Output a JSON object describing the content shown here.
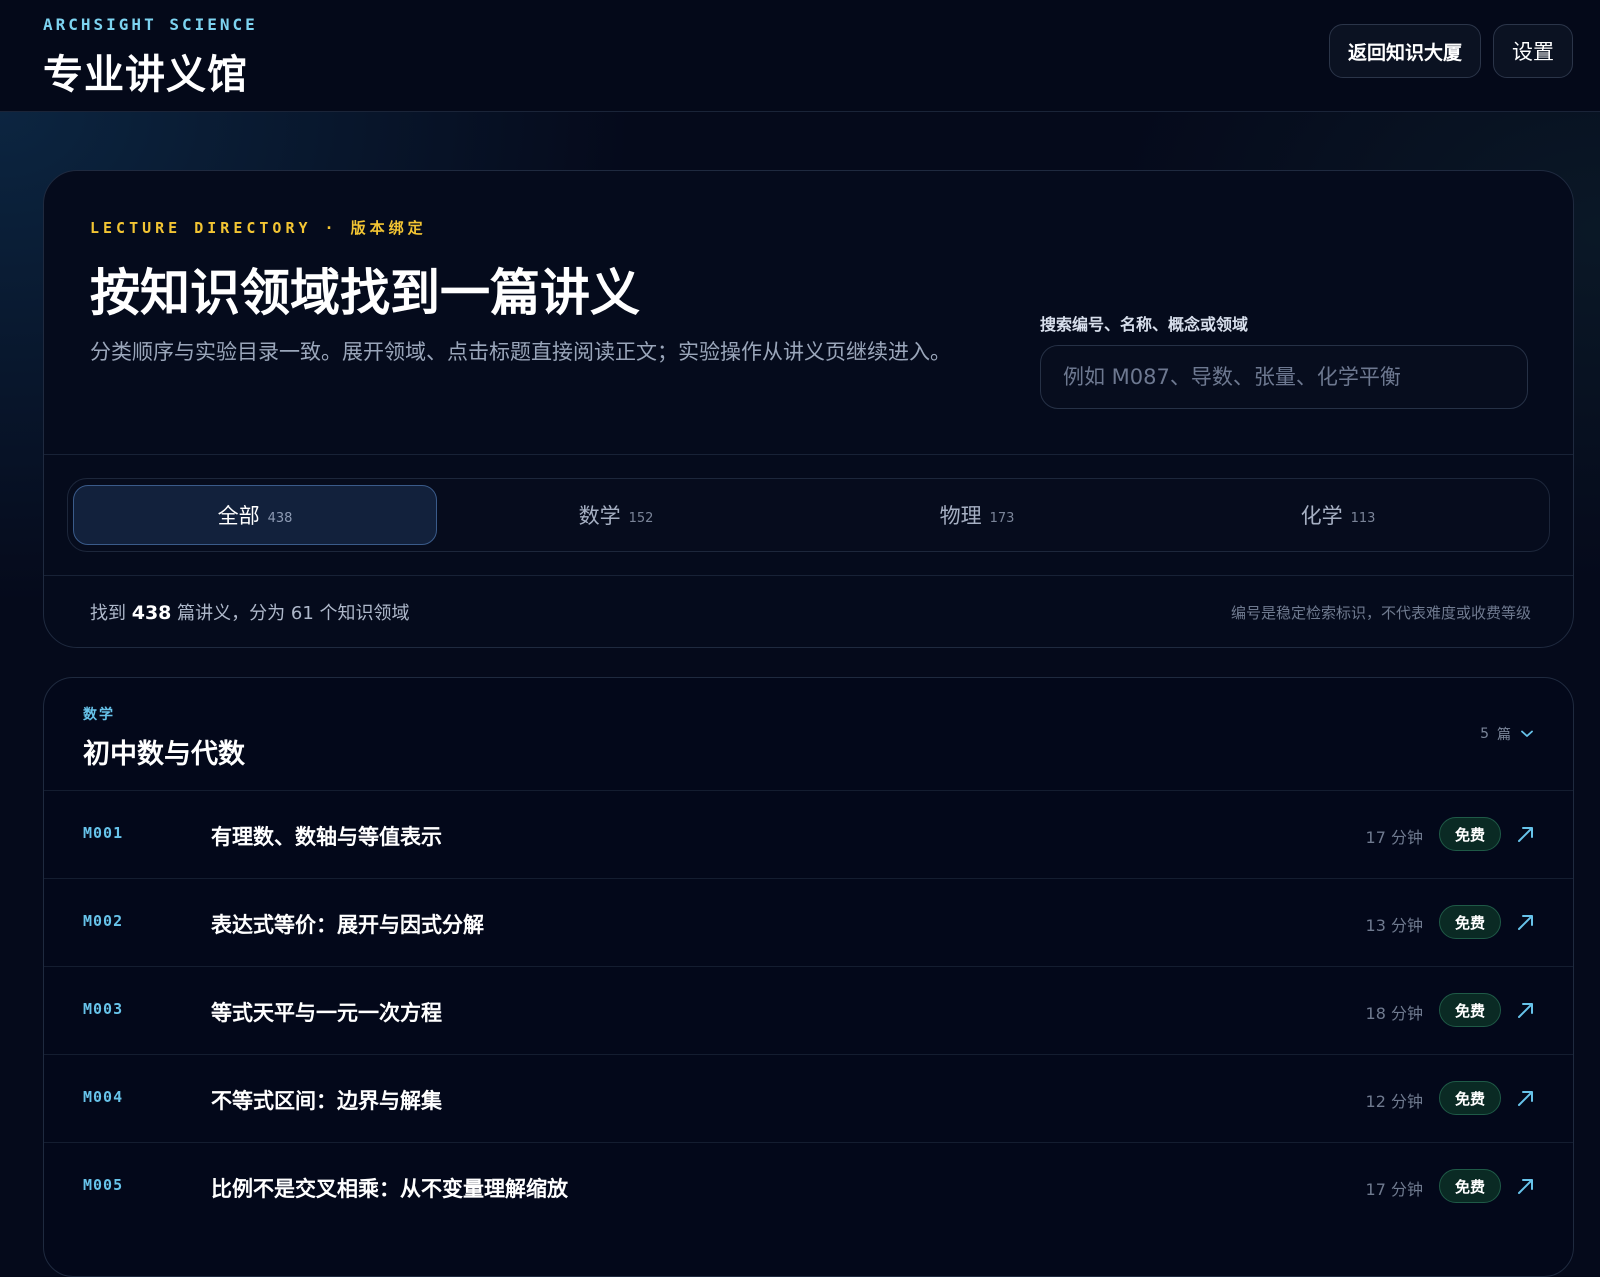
{
  "header": {
    "brand_kicker": "ARCHSIGHT SCIENCE",
    "brand_title": "专业讲义馆",
    "back_button": "返回知识大厦",
    "settings_button": "设置"
  },
  "directory": {
    "kicker": "LECTURE DIRECTORY · 版本绑定",
    "title": "按知识领域找到一篇讲义",
    "description": "分类顺序与实验目录一致。展开领域、点击标题直接阅读正文；实验操作从讲义页继续进入。",
    "search_label": "搜索编号、名称、概念或领域",
    "search_placeholder": "例如 M087、导数、张量、化学平衡",
    "search_value": "",
    "tabs": [
      {
        "label": "全部",
        "count": "438",
        "active": true
      },
      {
        "label": "数学",
        "count": "152",
        "active": false
      },
      {
        "label": "物理",
        "count": "173",
        "active": false
      },
      {
        "label": "化学",
        "count": "113",
        "active": false
      }
    ],
    "summary_prefix": "找到",
    "summary_count": "438",
    "summary_suffix": "篇讲义，分为 61 个知识领域",
    "note": "编号是稳定检索标识，不代表难度或收费等级"
  },
  "domain": {
    "kicker": "数学",
    "title": "初中数与代数",
    "count": "5",
    "count_unit": "篇",
    "lectures": [
      {
        "code": "M001",
        "title": "有理数、数轴与等值表示",
        "duration": "17 分钟",
        "badge": "免费"
      },
      {
        "code": "M002",
        "title": "表达式等价：展开与因式分解",
        "duration": "13 分钟",
        "badge": "免费"
      },
      {
        "code": "M003",
        "title": "等式天平与一元一次方程",
        "duration": "18 分钟",
        "badge": "免费"
      },
      {
        "code": "M004",
        "title": "不等式区间：边界与解集",
        "duration": "12 分钟",
        "badge": "免费"
      },
      {
        "code": "M005",
        "title": "比例不是交叉相乘：从不变量理解缩放",
        "duration": "17 分钟",
        "badge": "免费"
      }
    ]
  },
  "colors": {
    "accent_cyan": "#67c3ea",
    "accent_yellow": "#f3c533",
    "badge_green": "#0a2a24",
    "background": "#050a1b"
  },
  "icons": {
    "expand": "chevron-down-icon",
    "open": "arrow-up-right-icon"
  }
}
